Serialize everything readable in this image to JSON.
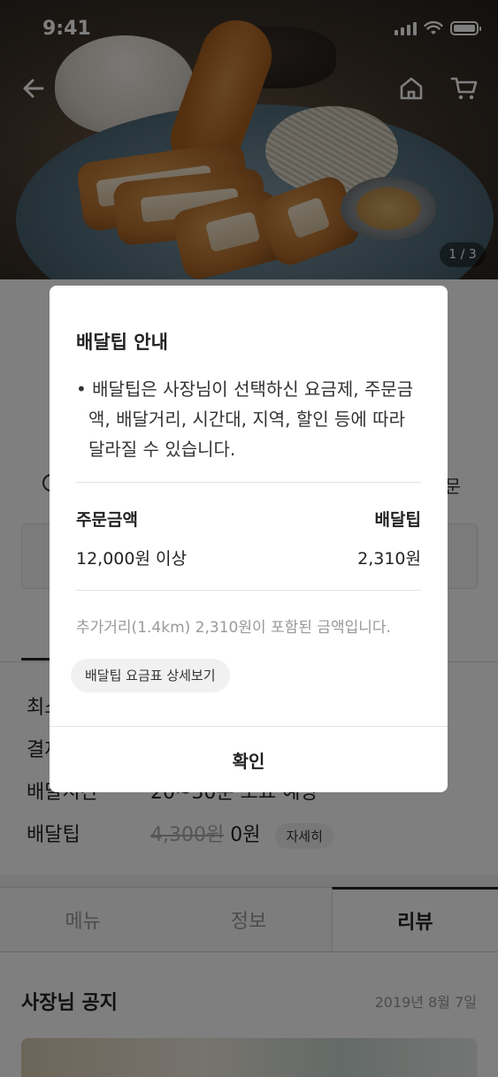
{
  "status_bar": {
    "time": "9:41"
  },
  "hero": {
    "photo_counter": "1 / 3"
  },
  "store_info": {
    "rows": [
      {
        "label": "최소주문",
        "value": ""
      },
      {
        "label": "결제",
        "value": ""
      },
      {
        "label": "배달시간",
        "value": "20~30분 소요 예상"
      }
    ],
    "delivery_tip": {
      "label": "배달팁",
      "original": "4,300원",
      "current": "0원",
      "detail_button": "자세히"
    },
    "right_text": "문"
  },
  "tabs": [
    {
      "label": "메뉴"
    },
    {
      "label": "정보"
    },
    {
      "label": "리뷰"
    }
  ],
  "notice": {
    "title": "사장님 공지",
    "date": "2019년 8월 7일"
  },
  "modal": {
    "title": "배달팁 안내",
    "description": "• 배달팁은 사장님이 선택하신 요금제, 주문금액, 배달거리, 시간대, 지역, 할인 등에 따라 달라질 수 있습니다.",
    "table": {
      "header_left": "주문금액",
      "header_right": "배달팁",
      "row_left": "12,000원 이상",
      "row_right": "2,310원"
    },
    "note": "추가거리(1.4km) 2,310원이 포함된 금액입니다.",
    "rate_link": "배달팁 요금표 상세보기",
    "confirm": "확인"
  }
}
